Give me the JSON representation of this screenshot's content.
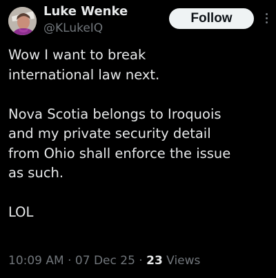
{
  "author": {
    "name": "Luke Wenke",
    "handle": "@KLukeIQ"
  },
  "follow_button": {
    "label": "Follow"
  },
  "more_menu": {
    "icon": "more-vertical-icon"
  },
  "tweet": {
    "text": "Wow I want to break\ninternational law next.\n\nNova Scotia belongs to Iroquois\nand my private security detail\nfrom Ohio shall enforce the issue\nas such.\n\nLOL"
  },
  "meta": {
    "time": "10:09 AM",
    "date": "07 Dec 25",
    "separator": " · ",
    "views_count": "23",
    "views_label": " Views"
  },
  "colors": {
    "background": "#000000",
    "primary_text": "#e7e9ea",
    "secondary_text": "#71767b",
    "follow_bg": "#eff3f4",
    "follow_text": "#0f1419"
  }
}
